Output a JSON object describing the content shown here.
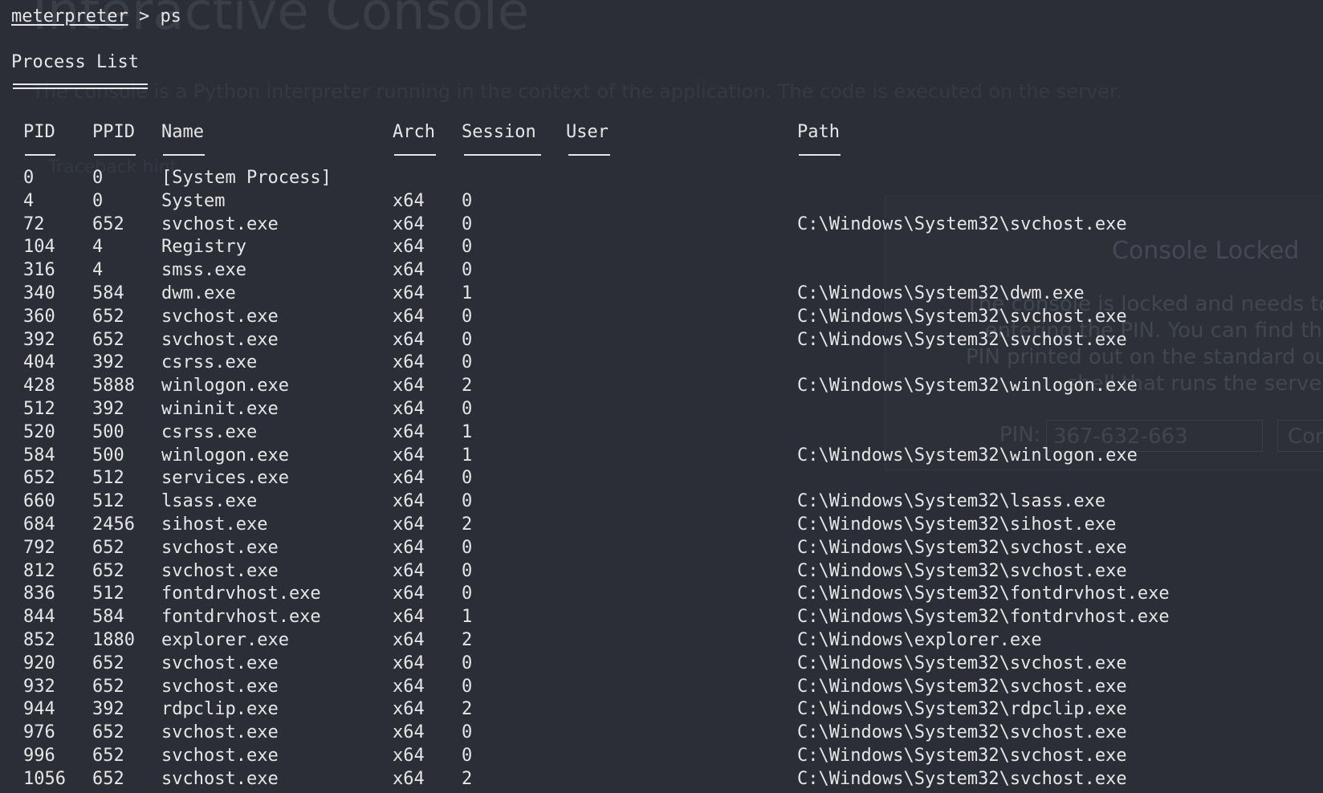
{
  "background": {
    "title": "Interactive Console",
    "description": "The console is a Python interpreter running in the context of the application. The code is executed on the server.",
    "traceback_hint": "Traceback hint"
  },
  "lock_modal": {
    "title": "Console Locked",
    "message_lines": [
      "The console is locked and needs to be unlocked by",
      "entering the PIN. You can find the",
      "PIN printed out on the standard output of your",
      "shell that runs the server."
    ],
    "pin_label": "PIN:",
    "pin_value": "367-632-663",
    "confirm_label": "Confirm"
  },
  "terminal": {
    "prompt_name": "meterpreter",
    "prompt_rest": " > ps",
    "section_title": "Process List",
    "columns": [
      "PID",
      "PPID",
      "Name",
      "Arch",
      "Session",
      "User",
      "Path"
    ],
    "rows": [
      {
        "pid": "0",
        "ppid": "0",
        "name": "[System Process]",
        "arch": "",
        "session": "",
        "user": "",
        "path": ""
      },
      {
        "pid": "4",
        "ppid": "0",
        "name": "System",
        "arch": "x64",
        "session": "0",
        "user": "",
        "path": ""
      },
      {
        "pid": "72",
        "ppid": "652",
        "name": "svchost.exe",
        "arch": "x64",
        "session": "0",
        "user": "",
        "path": "C:\\Windows\\System32\\svchost.exe"
      },
      {
        "pid": "104",
        "ppid": "4",
        "name": "Registry",
        "arch": "x64",
        "session": "0",
        "user": "",
        "path": ""
      },
      {
        "pid": "316",
        "ppid": "4",
        "name": "smss.exe",
        "arch": "x64",
        "session": "0",
        "user": "",
        "path": ""
      },
      {
        "pid": "340",
        "ppid": "584",
        "name": "dwm.exe",
        "arch": "x64",
        "session": "1",
        "user": "",
        "path": "C:\\Windows\\System32\\dwm.exe"
      },
      {
        "pid": "360",
        "ppid": "652",
        "name": "svchost.exe",
        "arch": "x64",
        "session": "0",
        "user": "",
        "path": "C:\\Windows\\System32\\svchost.exe"
      },
      {
        "pid": "392",
        "ppid": "652",
        "name": "svchost.exe",
        "arch": "x64",
        "session": "0",
        "user": "",
        "path": "C:\\Windows\\System32\\svchost.exe"
      },
      {
        "pid": "404",
        "ppid": "392",
        "name": "csrss.exe",
        "arch": "x64",
        "session": "0",
        "user": "",
        "path": ""
      },
      {
        "pid": "428",
        "ppid": "5888",
        "name": "winlogon.exe",
        "arch": "x64",
        "session": "2",
        "user": "",
        "path": "C:\\Windows\\System32\\winlogon.exe"
      },
      {
        "pid": "512",
        "ppid": "392",
        "name": "wininit.exe",
        "arch": "x64",
        "session": "0",
        "user": "",
        "path": ""
      },
      {
        "pid": "520",
        "ppid": "500",
        "name": "csrss.exe",
        "arch": "x64",
        "session": "1",
        "user": "",
        "path": ""
      },
      {
        "pid": "584",
        "ppid": "500",
        "name": "winlogon.exe",
        "arch": "x64",
        "session": "1",
        "user": "",
        "path": "C:\\Windows\\System32\\winlogon.exe"
      },
      {
        "pid": "652",
        "ppid": "512",
        "name": "services.exe",
        "arch": "x64",
        "session": "0",
        "user": "",
        "path": ""
      },
      {
        "pid": "660",
        "ppid": "512",
        "name": "lsass.exe",
        "arch": "x64",
        "session": "0",
        "user": "",
        "path": "C:\\Windows\\System32\\lsass.exe"
      },
      {
        "pid": "684",
        "ppid": "2456",
        "name": "sihost.exe",
        "arch": "x64",
        "session": "2",
        "user": "",
        "path": "C:\\Windows\\System32\\sihost.exe"
      },
      {
        "pid": "792",
        "ppid": "652",
        "name": "svchost.exe",
        "arch": "x64",
        "session": "0",
        "user": "",
        "path": "C:\\Windows\\System32\\svchost.exe"
      },
      {
        "pid": "812",
        "ppid": "652",
        "name": "svchost.exe",
        "arch": "x64",
        "session": "0",
        "user": "",
        "path": "C:\\Windows\\System32\\svchost.exe"
      },
      {
        "pid": "836",
        "ppid": "512",
        "name": "fontdrvhost.exe",
        "arch": "x64",
        "session": "0",
        "user": "",
        "path": "C:\\Windows\\System32\\fontdrvhost.exe"
      },
      {
        "pid": "844",
        "ppid": "584",
        "name": "fontdrvhost.exe",
        "arch": "x64",
        "session": "1",
        "user": "",
        "path": "C:\\Windows\\System32\\fontdrvhost.exe"
      },
      {
        "pid": "852",
        "ppid": "1880",
        "name": "explorer.exe",
        "arch": "x64",
        "session": "2",
        "user": "",
        "path": "C:\\Windows\\explorer.exe"
      },
      {
        "pid": "920",
        "ppid": "652",
        "name": "svchost.exe",
        "arch": "x64",
        "session": "0",
        "user": "",
        "path": "C:\\Windows\\System32\\svchost.exe"
      },
      {
        "pid": "932",
        "ppid": "652",
        "name": "svchost.exe",
        "arch": "x64",
        "session": "0",
        "user": "",
        "path": "C:\\Windows\\System32\\svchost.exe"
      },
      {
        "pid": "944",
        "ppid": "392",
        "name": "rdpclip.exe",
        "arch": "x64",
        "session": "2",
        "user": "",
        "path": "C:\\Windows\\System32\\rdpclip.exe"
      },
      {
        "pid": "976",
        "ppid": "652",
        "name": "svchost.exe",
        "arch": "x64",
        "session": "0",
        "user": "",
        "path": "C:\\Windows\\System32\\svchost.exe"
      },
      {
        "pid": "996",
        "ppid": "652",
        "name": "svchost.exe",
        "arch": "x64",
        "session": "0",
        "user": "",
        "path": "C:\\Windows\\System32\\svchost.exe"
      },
      {
        "pid": "1056",
        "ppid": "652",
        "name": "svchost.exe",
        "arch": "x64",
        "session": "2",
        "user": "",
        "path": "C:\\Windows\\System32\\svchost.exe"
      }
    ]
  }
}
